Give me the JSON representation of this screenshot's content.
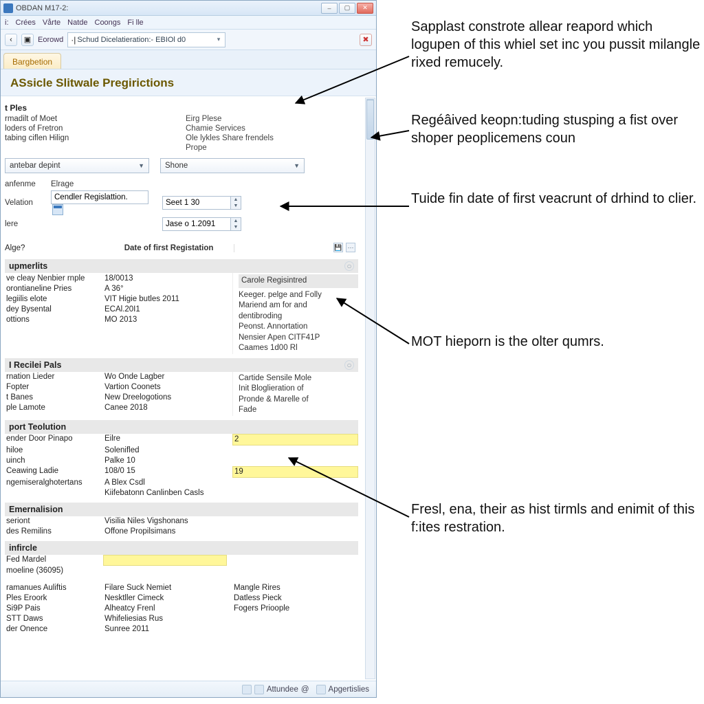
{
  "window": {
    "title": "OBDAN M17-2:",
    "menu": [
      "i:",
      "Crées",
      "Vårte",
      "Natde",
      "Coongs",
      "Fi lle"
    ],
    "toolbar": {
      "back_icon": "‹",
      "record_label": "Eorowd",
      "address_prefix": "·|",
      "address_value": "Schud Dicelatieration:- EBIOl d0",
      "dropdown_caret": "▾",
      "stop_icon": "✖"
    },
    "tab": "Bargbetion",
    "page_title": "ASsicle Slitwale Pregirictions"
  },
  "ples": {
    "heading": "t Ples",
    "left": [
      "rmadilt of Moet",
      "loders of Fretron",
      "tabing ciflen Hilign"
    ],
    "right_label": "Eirg Plese",
    "right": [
      "Chamie Services",
      "Ole lykles Share frendels",
      "Prope"
    ]
  },
  "combos": {
    "left": "antebar depint",
    "right": "Shone"
  },
  "form": {
    "col_a": "anfenme",
    "col_b": "Elrage",
    "row1_label": "Velation",
    "row1_value": "Cendler Regislattion.",
    "date1": "Seet 1 30",
    "row2_label": "lere",
    "date2": "Jase o 1.2091"
  },
  "q": {
    "label": "Alge?",
    "tag": "Date of first Registation"
  },
  "panel1": {
    "title": "upmerlits",
    "rows": [
      [
        "ve cleay Nenbier rnple",
        "18/0013"
      ],
      [
        "orontianeline Pries",
        "A 36°"
      ],
      [
        "legiilis elote",
        "VIT Higie butles 2011"
      ],
      [
        "dey Bysental",
        "ECAl.20I1"
      ],
      [
        "ottions",
        "MO 2013"
      ]
    ],
    "side_head": "Carole Regisintred",
    "side_lines": [
      "Keeger. pelge and Folly",
      "Mariend am for and",
      "dentibroding",
      "Peonst. Annortation",
      "Nensier Apen CITF41P",
      "Caames 1d00 Rl"
    ]
  },
  "panel2": {
    "title": "I Recilei Pals",
    "rows": [
      [
        "rnation Lieder",
        "Wo Onde Lagber"
      ],
      [
        "Fopter",
        "Vartion Coonets"
      ],
      [
        "t Banes",
        "New Dreelogotions"
      ],
      [
        "ple Lamote",
        "Canee 2018"
      ]
    ],
    "side_lines": [
      "Cartide Sensile Mole",
      "Init Bloglieration of",
      "Pronde & Marelle of",
      "Fade"
    ]
  },
  "panel3": {
    "title": "port Teolution",
    "rows": [
      [
        "ender Door Pinapo",
        "Eilre"
      ],
      [
        "hiloe",
        "Solenifled"
      ],
      [
        "uinch",
        "Palke 10"
      ],
      [
        "Ceawing Ladie",
        "108/0 15"
      ],
      [
        "ngemiseralghotertans",
        "A Blex Csdl"
      ],
      [
        "",
        "Kiifebatonn Canlinben Casls"
      ]
    ],
    "hl": {
      "0": "2",
      "3": "19"
    }
  },
  "panel4": {
    "title": "Emernalision",
    "rows": [
      [
        "seriont",
        "Visilia Niles Vigshonans"
      ],
      [
        "des Remilins",
        "Offone Propilsimans"
      ]
    ]
  },
  "panel5": {
    "title": "infircle",
    "rows": [
      [
        "Fed Mardel",
        ""
      ],
      [
        "moeline (36095)",
        ""
      ]
    ],
    "tail_left": [
      "ramanues Auliftis",
      "Ples Eroork",
      "Si9P Pais",
      "STT Daws",
      "der Onence"
    ],
    "tail_mid": [
      "Filare Suck Nemiet",
      "Nesktller Cimeck",
      "Alheatcy Frenl",
      "Whifeliesias Rus",
      "Sunree 2011"
    ],
    "tail_right": [
      "Mangle Rires",
      "Datless Pieck",
      "Fogers Prioople"
    ]
  },
  "status": {
    "a": "Attundee",
    "a_icon": "@",
    "b": "Apgertislies"
  },
  "callouts": [
    "Sapplast constrote allear reapord which logupen of this whiel set inc you pussit milangle rixed remucely.",
    "Regéâived keopn:tuding stusping a fist over shoper peoplicemens coun",
    "Tuide fin date of first veacrunt of drhind to clier.",
    "MOT hieporn is the olter qumrs.",
    "Fresl, ena, their as hist tirmls and enimit of this f:ites restration."
  ]
}
